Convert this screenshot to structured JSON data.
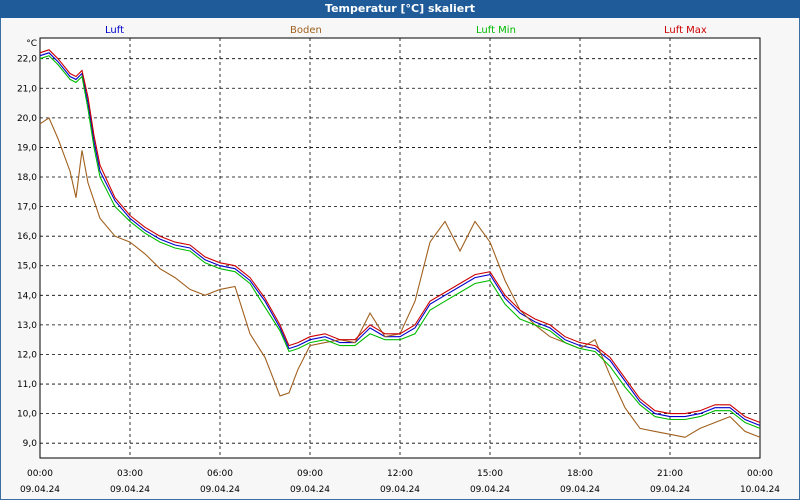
{
  "chart_data": {
    "type": "line",
    "title": "Temperatur [°C] skaliert",
    "ylabel": "°C",
    "ylim": [
      8.5,
      22.7
    ],
    "yticks": [
      9,
      10,
      11,
      12,
      13,
      14,
      15,
      16,
      17,
      18,
      19,
      20,
      21,
      22
    ],
    "ytick_labels": [
      "9,0",
      "10,0",
      "11,0",
      "12,0",
      "13,0",
      "14,0",
      "15,0",
      "16,0",
      "17,0",
      "18,0",
      "19,0",
      "20,0",
      "21,0",
      "22,0"
    ],
    "xlim": [
      0,
      24
    ],
    "xticks": [
      {
        "hour": 0,
        "time": "00:00",
        "date": "09.04.24"
      },
      {
        "hour": 3,
        "time": "03:00",
        "date": "09.04.24"
      },
      {
        "hour": 6,
        "time": "06:00",
        "date": "09.04.24"
      },
      {
        "hour": 9,
        "time": "09:00",
        "date": "09.04.24"
      },
      {
        "hour": 12,
        "time": "12:00",
        "date": "09.04.24"
      },
      {
        "hour": 15,
        "time": "15:00",
        "date": "09.04.24"
      },
      {
        "hour": 18,
        "time": "18:00",
        "date": "09.04.24"
      },
      {
        "hour": 21,
        "time": "21:00",
        "date": "09.04.24"
      },
      {
        "hour": 24,
        "time": "00:00",
        "date": "10.04.24"
      }
    ],
    "grid": true,
    "legend_position": "top",
    "series": [
      {
        "name": "Luft",
        "color": "#0000cc",
        "x": [
          0,
          0.3,
          0.6,
          1.0,
          1.2,
          1.4,
          1.6,
          1.8,
          2.0,
          2.5,
          3.0,
          3.5,
          4.0,
          4.5,
          5.0,
          5.5,
          6.0,
          6.5,
          7.0,
          7.5,
          8.0,
          8.3,
          8.6,
          9.0,
          9.5,
          10.0,
          10.5,
          11.0,
          11.5,
          12.0,
          12.5,
          13.0,
          13.5,
          14.0,
          14.5,
          15.0,
          15.5,
          16.0,
          16.5,
          17.0,
          17.5,
          18.0,
          18.5,
          19.0,
          19.5,
          20.0,
          20.5,
          21.0,
          21.5,
          22.0,
          22.5,
          23.0,
          23.5,
          24.0
        ],
        "y": [
          22.1,
          22.2,
          21.9,
          21.4,
          21.3,
          21.5,
          20.5,
          19.2,
          18.2,
          17.2,
          16.6,
          16.2,
          15.9,
          15.7,
          15.6,
          15.2,
          15.0,
          14.9,
          14.5,
          13.8,
          12.9,
          12.2,
          12.3,
          12.5,
          12.6,
          12.4,
          12.4,
          12.9,
          12.6,
          12.6,
          12.9,
          13.7,
          14.0,
          14.3,
          14.6,
          14.7,
          13.9,
          13.4,
          13.1,
          12.9,
          12.5,
          12.3,
          12.2,
          11.8,
          11.1,
          10.4,
          10.0,
          9.9,
          9.9,
          10.0,
          10.2,
          10.2,
          9.8,
          9.6
        ]
      },
      {
        "name": "Boden",
        "color": "#a0601e",
        "x": [
          0,
          0.3,
          0.6,
          1.0,
          1.2,
          1.4,
          1.6,
          1.8,
          2.0,
          2.5,
          3.0,
          3.5,
          4.0,
          4.5,
          5.0,
          5.5,
          6.0,
          6.5,
          7.0,
          7.5,
          8.0,
          8.3,
          8.6,
          9.0,
          9.5,
          10.0,
          10.5,
          11.0,
          11.5,
          12.0,
          12.5,
          13.0,
          13.5,
          14.0,
          14.5,
          15.0,
          15.5,
          16.0,
          16.5,
          17.0,
          17.5,
          18.0,
          18.5,
          19.0,
          19.5,
          20.0,
          20.5,
          21.0,
          21.5,
          22.0,
          22.5,
          23.0,
          23.5,
          24.0
        ],
        "y": [
          19.8,
          20.0,
          19.3,
          18.2,
          17.3,
          18.9,
          17.8,
          17.2,
          16.6,
          16.0,
          15.8,
          15.4,
          14.9,
          14.6,
          14.2,
          14.0,
          14.2,
          14.3,
          12.7,
          11.9,
          10.6,
          10.7,
          11.5,
          12.3,
          12.4,
          12.5,
          12.4,
          13.4,
          12.6,
          12.7,
          13.8,
          15.8,
          16.5,
          15.5,
          16.5,
          15.8,
          14.5,
          13.5,
          13.0,
          12.6,
          12.4,
          12.2,
          12.5,
          11.3,
          10.2,
          9.5,
          9.4,
          9.3,
          9.2,
          9.5,
          9.7,
          9.9,
          9.4,
          9.2
        ]
      },
      {
        "name": "Luft Min",
        "color": "#00bb00",
        "x": [
          0,
          0.3,
          0.6,
          1.0,
          1.2,
          1.4,
          1.6,
          1.8,
          2.0,
          2.5,
          3.0,
          3.5,
          4.0,
          4.5,
          5.0,
          5.5,
          6.0,
          6.5,
          7.0,
          7.5,
          8.0,
          8.3,
          8.6,
          9.0,
          9.5,
          10.0,
          10.5,
          11.0,
          11.5,
          12.0,
          12.5,
          13.0,
          13.5,
          14.0,
          14.5,
          15.0,
          15.5,
          16.0,
          16.5,
          17.0,
          17.5,
          18.0,
          18.5,
          19.0,
          19.5,
          20.0,
          20.5,
          21.0,
          21.5,
          22.0,
          22.5,
          23.0,
          23.5,
          24.0
        ],
        "y": [
          22.0,
          22.1,
          21.8,
          21.3,
          21.2,
          21.4,
          20.3,
          19.0,
          18.0,
          17.0,
          16.5,
          16.1,
          15.8,
          15.6,
          15.5,
          15.1,
          14.9,
          14.8,
          14.4,
          13.6,
          12.8,
          12.1,
          12.2,
          12.4,
          12.5,
          12.3,
          12.3,
          12.7,
          12.5,
          12.5,
          12.7,
          13.5,
          13.8,
          14.1,
          14.4,
          14.5,
          13.7,
          13.2,
          13.0,
          12.8,
          12.4,
          12.2,
          12.1,
          11.6,
          10.9,
          10.3,
          9.9,
          9.8,
          9.8,
          9.9,
          10.1,
          10.1,
          9.7,
          9.5
        ]
      },
      {
        "name": "Luft Max",
        "color": "#cc0000",
        "x": [
          0,
          0.3,
          0.6,
          1.0,
          1.2,
          1.4,
          1.6,
          1.8,
          2.0,
          2.5,
          3.0,
          3.5,
          4.0,
          4.5,
          5.0,
          5.5,
          6.0,
          6.5,
          7.0,
          7.5,
          8.0,
          8.3,
          8.6,
          9.0,
          9.5,
          10.0,
          10.5,
          11.0,
          11.5,
          12.0,
          12.5,
          13.0,
          13.5,
          14.0,
          14.5,
          15.0,
          15.5,
          16.0,
          16.5,
          17.0,
          17.5,
          18.0,
          18.5,
          19.0,
          19.5,
          20.0,
          20.5,
          21.0,
          21.5,
          22.0,
          22.5,
          23.0,
          23.5,
          24.0
        ],
        "y": [
          22.2,
          22.3,
          22.0,
          21.5,
          21.4,
          21.6,
          20.7,
          19.4,
          18.4,
          17.3,
          16.7,
          16.3,
          16.0,
          15.8,
          15.7,
          15.3,
          15.1,
          15.0,
          14.6,
          13.9,
          13.0,
          12.3,
          12.4,
          12.6,
          12.7,
          12.5,
          12.5,
          13.0,
          12.7,
          12.7,
          13.0,
          13.8,
          14.1,
          14.4,
          14.7,
          14.8,
          14.0,
          13.5,
          13.2,
          13.0,
          12.6,
          12.4,
          12.3,
          11.9,
          11.2,
          10.5,
          10.1,
          10.0,
          10.0,
          10.1,
          10.3,
          10.3,
          9.9,
          9.7
        ]
      }
    ]
  }
}
